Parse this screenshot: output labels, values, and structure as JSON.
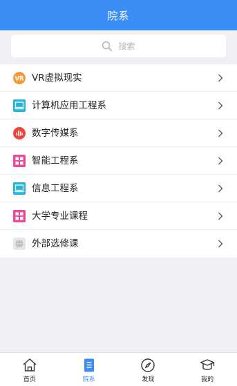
{
  "header": {
    "title": "院系"
  },
  "search": {
    "placeholder": "搜索",
    "icon": "search-icon"
  },
  "list": {
    "items": [
      {
        "label": "VR虚拟现实",
        "icon": "vr-icon",
        "color": "#f29b38"
      },
      {
        "label": "计算机应用工程系",
        "icon": "laptop-icon",
        "color": "#21b7d8"
      },
      {
        "label": "数字传媒系",
        "icon": "audio-bars-icon",
        "color": "#f0433c"
      },
      {
        "label": "智能工程系",
        "icon": "grid-apps-icon",
        "color": "#ee4a9c"
      },
      {
        "label": "信息工程系",
        "icon": "laptop-icon",
        "color": "#21b7d8"
      },
      {
        "label": "大学专业课程",
        "icon": "grid-apps-icon",
        "color": "#ee4a9c"
      },
      {
        "label": "外部选修课",
        "icon": "globe-icon",
        "color": "#b8b8b8"
      }
    ]
  },
  "tabbar": {
    "tabs": [
      {
        "label": "首页",
        "icon": "home-icon",
        "active": false
      },
      {
        "label": "院系",
        "icon": "document-list-icon",
        "active": true
      },
      {
        "label": "发现",
        "icon": "compass-icon",
        "active": false
      },
      {
        "label": "我的",
        "icon": "user-cap-icon",
        "active": false
      }
    ]
  },
  "colors": {
    "accent": "#3a8ef6",
    "background": "#eff0f4"
  }
}
